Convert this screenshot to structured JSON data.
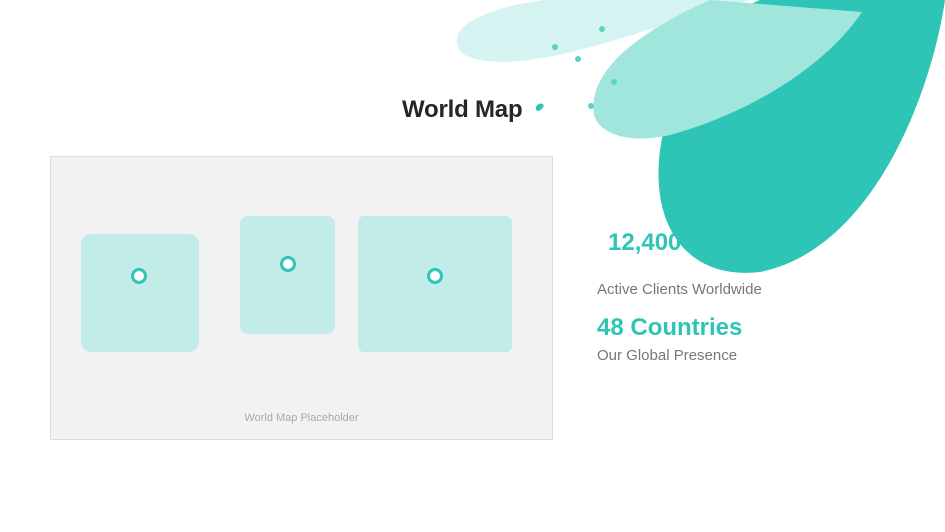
{
  "page": {
    "title": "World Map"
  },
  "map": {
    "caption": "World Map Placeholder",
    "regions": 3,
    "markers": 3
  },
  "stats": [
    {
      "value": "12,400+",
      "label": "Active Clients Worldwide"
    },
    {
      "value": "48 Countries",
      "label": "Our Global Presence"
    }
  ],
  "colors": {
    "accent": "#2ec5b6",
    "accent_medium": "#a1e6dd",
    "accent_light": "#d5f3f0",
    "region_fill": "#c1ece8",
    "map_background": "#f2f2f2",
    "title_text": "#262626",
    "muted_text": "#777777"
  },
  "icons": {
    "title_accent": "teal-drop-icon",
    "map_marker": "location-pin-icon"
  }
}
